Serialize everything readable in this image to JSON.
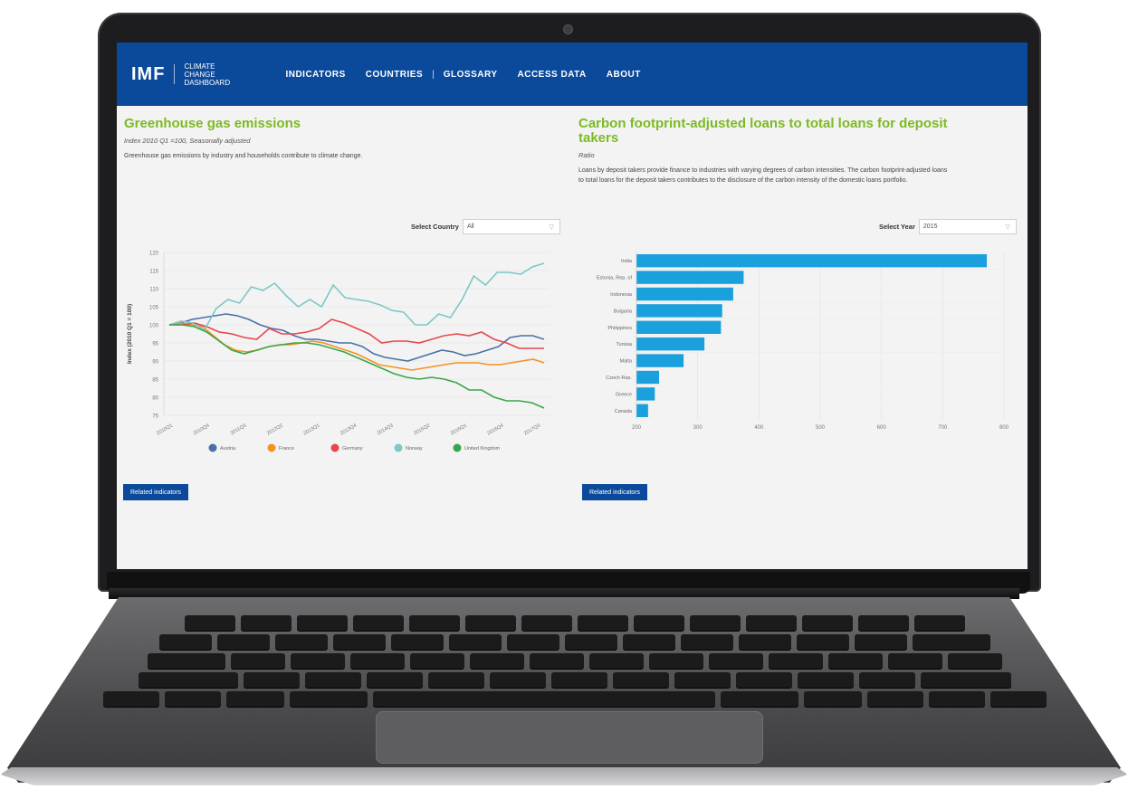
{
  "nav": {
    "logo": "IMF",
    "logo_sub": "CLIMATE CHANGE DASHBOARD",
    "items": [
      "INDICATORS",
      "COUNTRIES",
      "GLOSSARY",
      "ACCESS DATA",
      "ABOUT"
    ],
    "separator": "|"
  },
  "colors": {
    "nav_bg": "#0b4a9b",
    "title_green": "#7cba24",
    "bar_blue": "#1aa0dc"
  },
  "left": {
    "title": "Greenhouse gas emissions",
    "subtitle": "Index 2010 Q1 =100, Seasonally adjusted",
    "description": "Greenhouse gas emissions by industry and households contribute to climate change.",
    "select_label": "Select Country",
    "select_value": "All",
    "button": "Related indicators"
  },
  "right": {
    "title": "Carbon footprint-adjusted loans to total loans for deposit takers",
    "subtitle": "Ratio",
    "description": "Loans by deposit takers provide finance to industries with varying degrees of carbon intensities. The carbon footprint-adjusted loans to total loans for the deposit takers contributes to the disclosure of the carbon intensity of the domestic loans portfolio.",
    "select_label": "Select Year",
    "select_value": "2015",
    "button": "Related indicators"
  },
  "chart_data": [
    {
      "type": "line",
      "ylabel": "Index (2010 Q1 = 100)",
      "ylim": [
        75,
        120
      ],
      "yticks": [
        75,
        80,
        85,
        90,
        95,
        100,
        105,
        110,
        115,
        120
      ],
      "xtick_labels": [
        "2010Q1",
        "2010Q4",
        "2011Q3",
        "2012Q2",
        "2013Q1",
        "2013Q4",
        "2014Q3",
        "2015Q2",
        "2016Q1",
        "2016Q4",
        "2017Q3"
      ],
      "legend_position": "bottom",
      "series": [
        {
          "name": "Austria",
          "color": "#4a70a8",
          "values": [
            100,
            100.5,
            101.5,
            102,
            102.5,
            103,
            102.5,
            101.5,
            100,
            99,
            98.5,
            97,
            96,
            96,
            95.5,
            95,
            95,
            94,
            92,
            91,
            90.5,
            90,
            91,
            92,
            93,
            92.5,
            91.5,
            92,
            93,
            94,
            96.5,
            97,
            97,
            96
          ]
        },
        {
          "name": "France",
          "color": "#f39322",
          "values": [
            100,
            100.5,
            100,
            99.5,
            97,
            94.5,
            93,
            92.5,
            93,
            94,
            94.5,
            94.5,
            95,
            95.5,
            95,
            94,
            93,
            92,
            90.5,
            89,
            88.5,
            88,
            87.5,
            88,
            88.5,
            89,
            89.5,
            89.5,
            89.5,
            89,
            89,
            89.5,
            90,
            90.5,
            89.5
          ]
        },
        {
          "name": "Germany",
          "color": "#e5474f",
          "values": [
            100,
            100,
            100.5,
            99.5,
            98,
            97.5,
            96.5,
            96,
            99,
            97.5,
            97.5,
            98,
            99,
            101.5,
            100.5,
            99,
            97.5,
            95,
            95.5,
            95.5,
            95,
            96,
            97,
            97.5,
            97,
            98,
            96,
            95,
            93.5,
            93.5,
            93.5
          ]
        },
        {
          "name": "Norway",
          "color": "#7cc7c7",
          "values": [
            100,
            101,
            100.5,
            98.5,
            104.5,
            107,
            106,
            110.5,
            109.5,
            111.5,
            108,
            105,
            107,
            105,
            111,
            107.5,
            107,
            106.5,
            105.5,
            104,
            103.5,
            100,
            100,
            103,
            102,
            107,
            113.5,
            111,
            114.5,
            114.5,
            114,
            116,
            117
          ]
        },
        {
          "name": "United Kingdom",
          "color": "#3aa64b",
          "values": [
            100,
            100,
            99.5,
            98,
            95.5,
            93,
            92,
            93,
            94,
            94.5,
            95,
            95,
            94.5,
            93.5,
            92.5,
            91,
            89.5,
            88,
            86.5,
            85.5,
            85,
            85.5,
            85,
            84,
            82,
            82,
            80,
            79,
            79,
            78.5,
            77
          ]
        }
      ]
    },
    {
      "type": "bar",
      "orientation": "horizontal",
      "categories": [
        "India",
        "Estonia, Rep. of",
        "Indonesia",
        "Bulgaria",
        "Philippines",
        "Tunisia",
        "Malta",
        "Czech Rep.",
        "Greece",
        "Canada"
      ],
      "values": [
        772,
        375,
        358,
        340,
        338,
        311,
        277,
        237,
        230,
        219
      ],
      "xlim": [
        200,
        800
      ],
      "xticks": [
        200,
        300,
        400,
        500,
        600,
        700,
        800
      ]
    }
  ]
}
